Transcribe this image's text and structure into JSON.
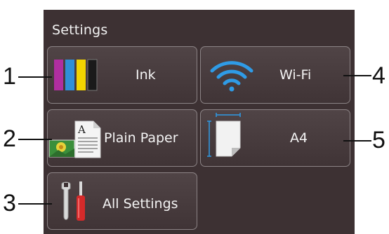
{
  "screen": {
    "title": "Settings",
    "tiles": [
      {
        "id": "ink",
        "label": "Ink",
        "icon": "ink-cartridges-icon"
      },
      {
        "id": "wifi",
        "label": "Wi-Fi",
        "icon": "wifi-icon"
      },
      {
        "id": "paper-type",
        "label": "Plain Paper",
        "icon": "plain-paper-icon"
      },
      {
        "id": "paper-size",
        "label": "A4",
        "icon": "paper-size-icon"
      },
      {
        "id": "all-settings",
        "label": "All Settings",
        "icon": "tools-icon"
      }
    ]
  },
  "callouts": [
    "1",
    "2",
    "3",
    "4",
    "5"
  ],
  "colors": {
    "screen_bg": "#3d3133",
    "tile_border": "#8c8486",
    "ink_magenta": "#b02ea0",
    "ink_cyan": "#2f8fd8",
    "ink_yellow": "#f2d400",
    "ink_black": "#1a1a1a",
    "wifi_blue": "#2f9be6"
  }
}
